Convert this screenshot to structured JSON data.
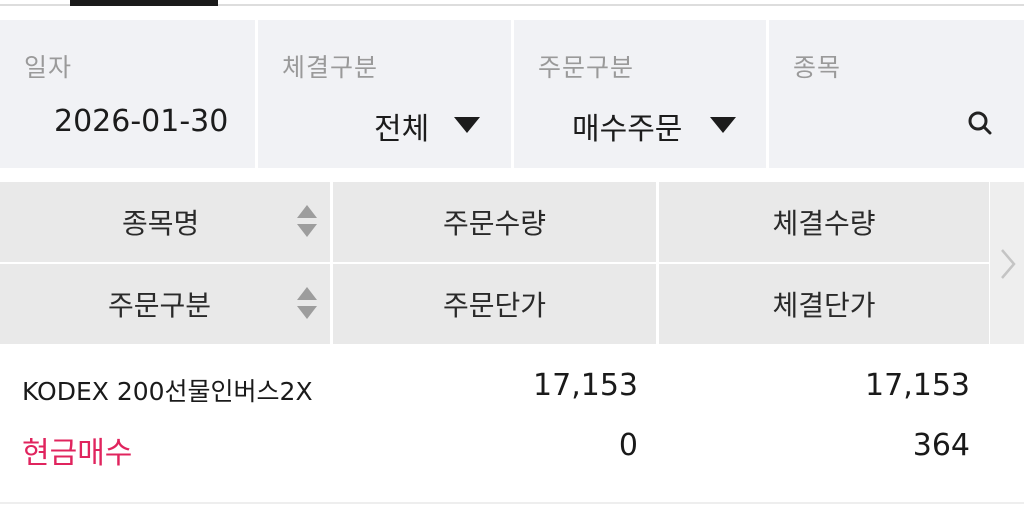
{
  "filters": {
    "date": {
      "label": "일자",
      "value": "2026-01-30"
    },
    "execution_type": {
      "label": "체결구분",
      "value": "전체"
    },
    "order_type": {
      "label": "주문구분",
      "value": "매수주문"
    },
    "stock": {
      "label": "종목"
    }
  },
  "table": {
    "columns_row1": [
      "종목명",
      "주문수량",
      "체결수량"
    ],
    "columns_row2": [
      "주문구분",
      "주문단가",
      "체결단가"
    ],
    "rows": [
      {
        "name": "KODEX 200선물인버스2X",
        "order_qty": "17,153",
        "exec_qty": "17,153",
        "type": "현금매수",
        "order_price": "0",
        "exec_price": "364"
      }
    ]
  },
  "colors": {
    "buy_type": "#e0245e",
    "filter_bg": "#f1f2f5",
    "header_bg": "#e9e9e9"
  },
  "icons": [
    "search-icon",
    "sort-icon",
    "dropdown-caret-icon",
    "chevron-right-icon"
  ]
}
